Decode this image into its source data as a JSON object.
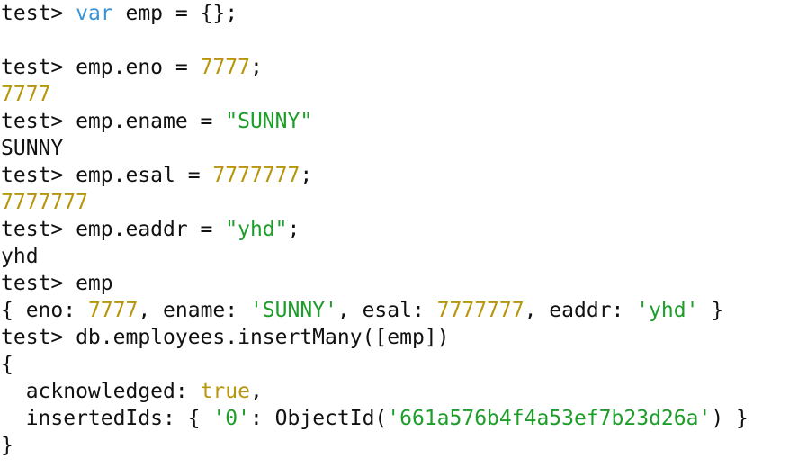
{
  "theme": {
    "background": "#ffffff",
    "default_text": "#111111",
    "keyword": "#3b93d6",
    "number": "#b8960b",
    "string": "#1d9e2a"
  },
  "terminal": {
    "lines": [
      {
        "kind": "input",
        "tokens": [
          {
            "t": "test> ",
            "c": "def"
          },
          {
            "t": "var",
            "c": "kw"
          },
          {
            "t": " emp = {};",
            "c": "def"
          }
        ]
      },
      {
        "kind": "blank",
        "tokens": []
      },
      {
        "kind": "input",
        "tokens": [
          {
            "t": "test> emp.eno = ",
            "c": "def"
          },
          {
            "t": "7777",
            "c": "num"
          },
          {
            "t": ";",
            "c": "def"
          }
        ]
      },
      {
        "kind": "output",
        "tokens": [
          {
            "t": "7777",
            "c": "num"
          }
        ]
      },
      {
        "kind": "input",
        "tokens": [
          {
            "t": "test> emp.ename = ",
            "c": "def"
          },
          {
            "t": "\"SUNNY\"",
            "c": "str"
          }
        ]
      },
      {
        "kind": "output",
        "tokens": [
          {
            "t": "SUNNY",
            "c": "def"
          }
        ]
      },
      {
        "kind": "input",
        "tokens": [
          {
            "t": "test> emp.esal = ",
            "c": "def"
          },
          {
            "t": "7777777",
            "c": "num"
          },
          {
            "t": ";",
            "c": "def"
          }
        ]
      },
      {
        "kind": "output",
        "tokens": [
          {
            "t": "7777777",
            "c": "num"
          }
        ]
      },
      {
        "kind": "input",
        "tokens": [
          {
            "t": "test> emp.eaddr = ",
            "c": "def"
          },
          {
            "t": "\"yhd\"",
            "c": "str"
          },
          {
            "t": ";",
            "c": "def"
          }
        ]
      },
      {
        "kind": "output",
        "tokens": [
          {
            "t": "yhd",
            "c": "def"
          }
        ]
      },
      {
        "kind": "input",
        "tokens": [
          {
            "t": "test> emp",
            "c": "def"
          }
        ]
      },
      {
        "kind": "output",
        "tokens": [
          {
            "t": "{ eno: ",
            "c": "def"
          },
          {
            "t": "7777",
            "c": "num"
          },
          {
            "t": ", ename: ",
            "c": "def"
          },
          {
            "t": "'SUNNY'",
            "c": "str"
          },
          {
            "t": ", esal: ",
            "c": "def"
          },
          {
            "t": "7777777",
            "c": "num"
          },
          {
            "t": ", eaddr: ",
            "c": "def"
          },
          {
            "t": "'yhd'",
            "c": "str"
          },
          {
            "t": " }",
            "c": "def"
          }
        ]
      },
      {
        "kind": "input",
        "tokens": [
          {
            "t": "test> db.employees.insertMany([emp])",
            "c": "def"
          }
        ]
      },
      {
        "kind": "output",
        "tokens": [
          {
            "t": "{",
            "c": "def"
          }
        ]
      },
      {
        "kind": "output",
        "tokens": [
          {
            "t": "  acknowledged: ",
            "c": "def"
          },
          {
            "t": "true",
            "c": "num"
          },
          {
            "t": ",",
            "c": "def"
          }
        ]
      },
      {
        "kind": "output",
        "tokens": [
          {
            "t": "  insertedIds: { ",
            "c": "def"
          },
          {
            "t": "'0'",
            "c": "str"
          },
          {
            "t": ": ObjectId(",
            "c": "def"
          },
          {
            "t": "'661a576b4f4a53ef7b23d26a'",
            "c": "str"
          },
          {
            "t": ") }",
            "c": "def"
          }
        ]
      },
      {
        "kind": "output",
        "tokens": [
          {
            "t": "}",
            "c": "def"
          }
        ]
      }
    ]
  }
}
